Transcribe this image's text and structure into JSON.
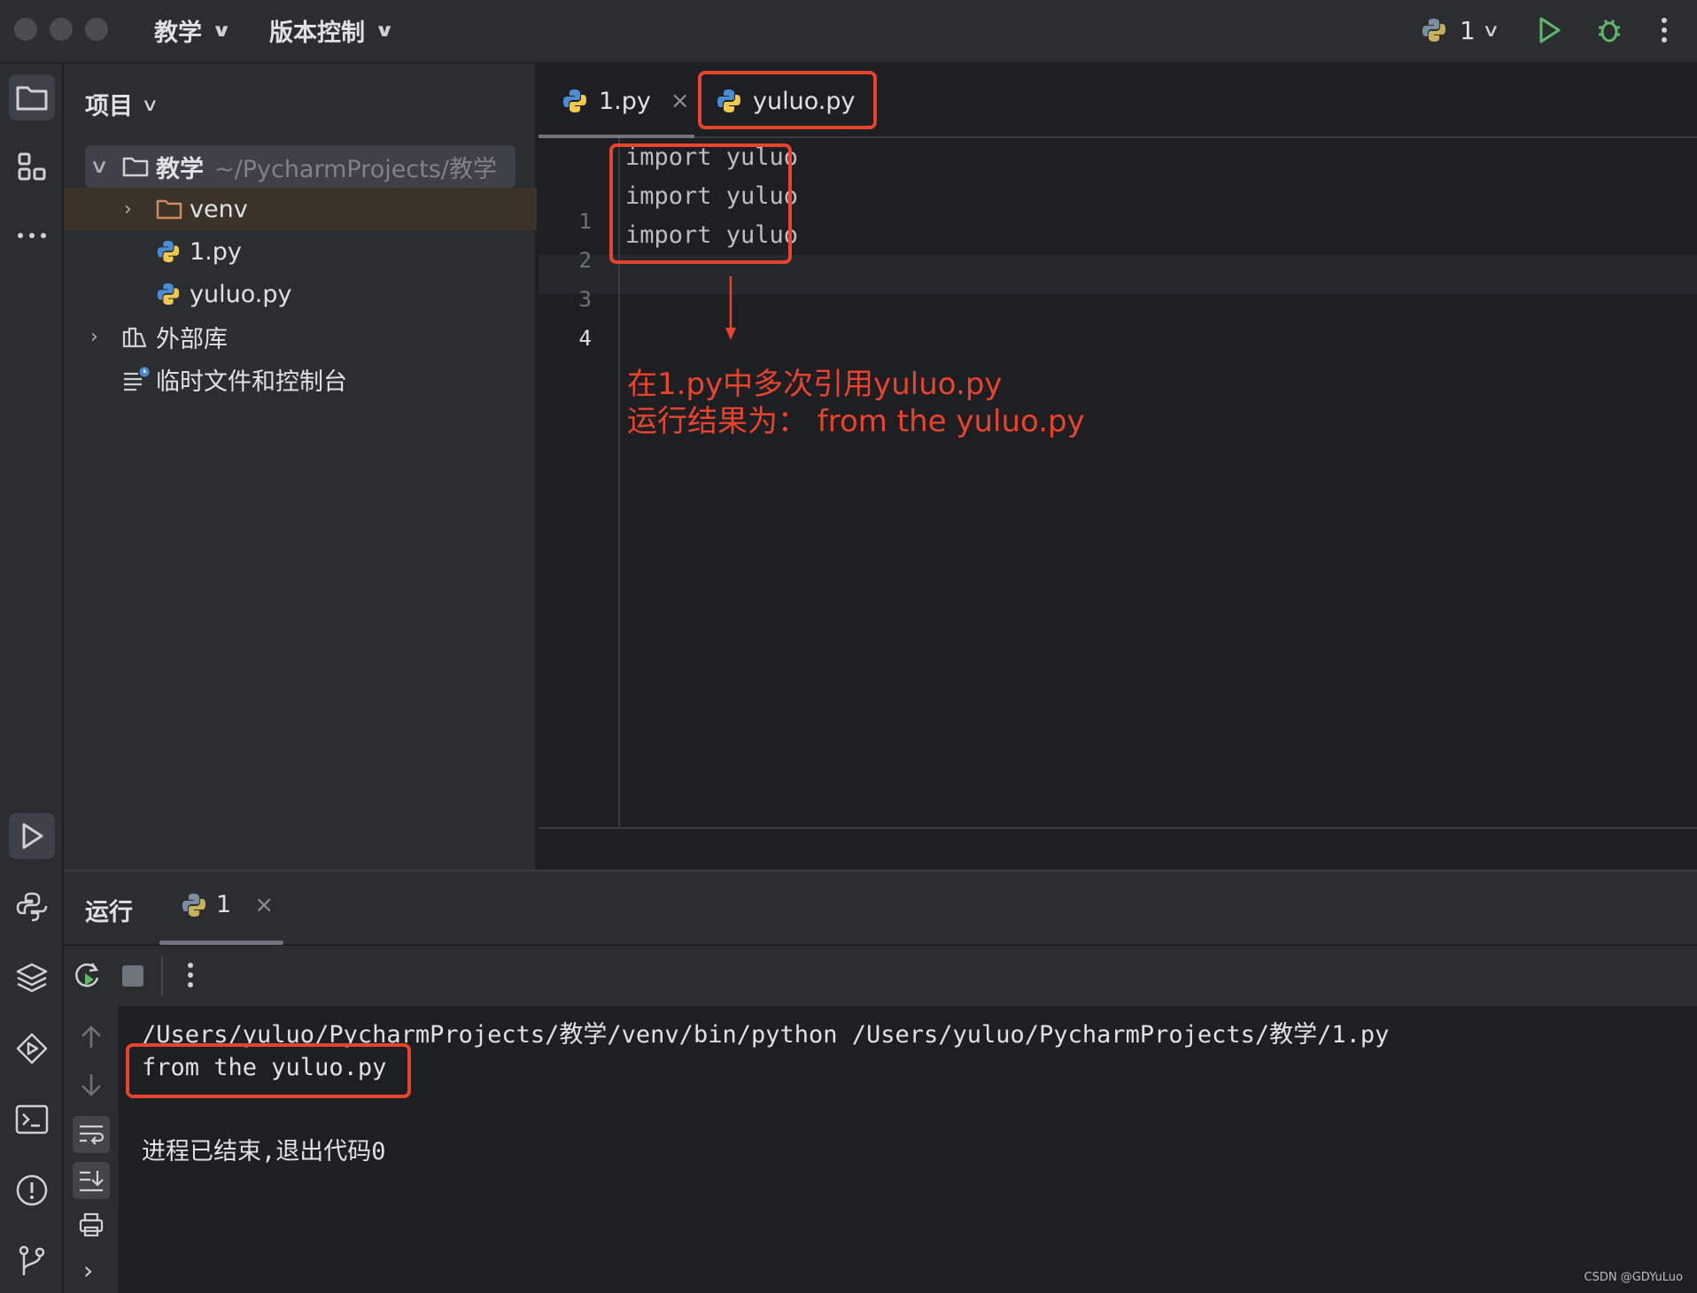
{
  "titlebar": {
    "project_menu": "教学",
    "vcs_menu": "版本控制",
    "run_config": "1"
  },
  "project_panel": {
    "title": "项目",
    "tree": {
      "root_name": "教学",
      "root_path": "~/PycharmProjects/教学",
      "venv": "venv",
      "file1": "1.py",
      "file2": "yuluo.py",
      "external_libs": "外部库",
      "scratches": "临时文件和控制台"
    }
  },
  "editor": {
    "tabs": [
      "1.py",
      "yuluo.py"
    ],
    "line_numbers": [
      "1",
      "2",
      "3",
      "4"
    ],
    "lines": [
      "import yuluo",
      "import yuluo",
      "import yuluo",
      ""
    ]
  },
  "annotation": {
    "line1": "在1.py中多次引用yuluo.py",
    "line2": "运行结果为： from the yuluo.py"
  },
  "run_panel": {
    "title": "运行",
    "tab_label": "1",
    "output": [
      "/Users/yuluo/PycharmProjects/教学/venv/bin/python /Users/yuluo/PycharmProjects/教学/1.py",
      "from the yuluo.py",
      "进程已结束,退出代码0"
    ]
  },
  "watermark": "CSDN @GDYuLuo",
  "colors": {
    "accent_red": "#e8432c",
    "run_green": "#5fb865",
    "folder_orange": "#d08b5c"
  }
}
